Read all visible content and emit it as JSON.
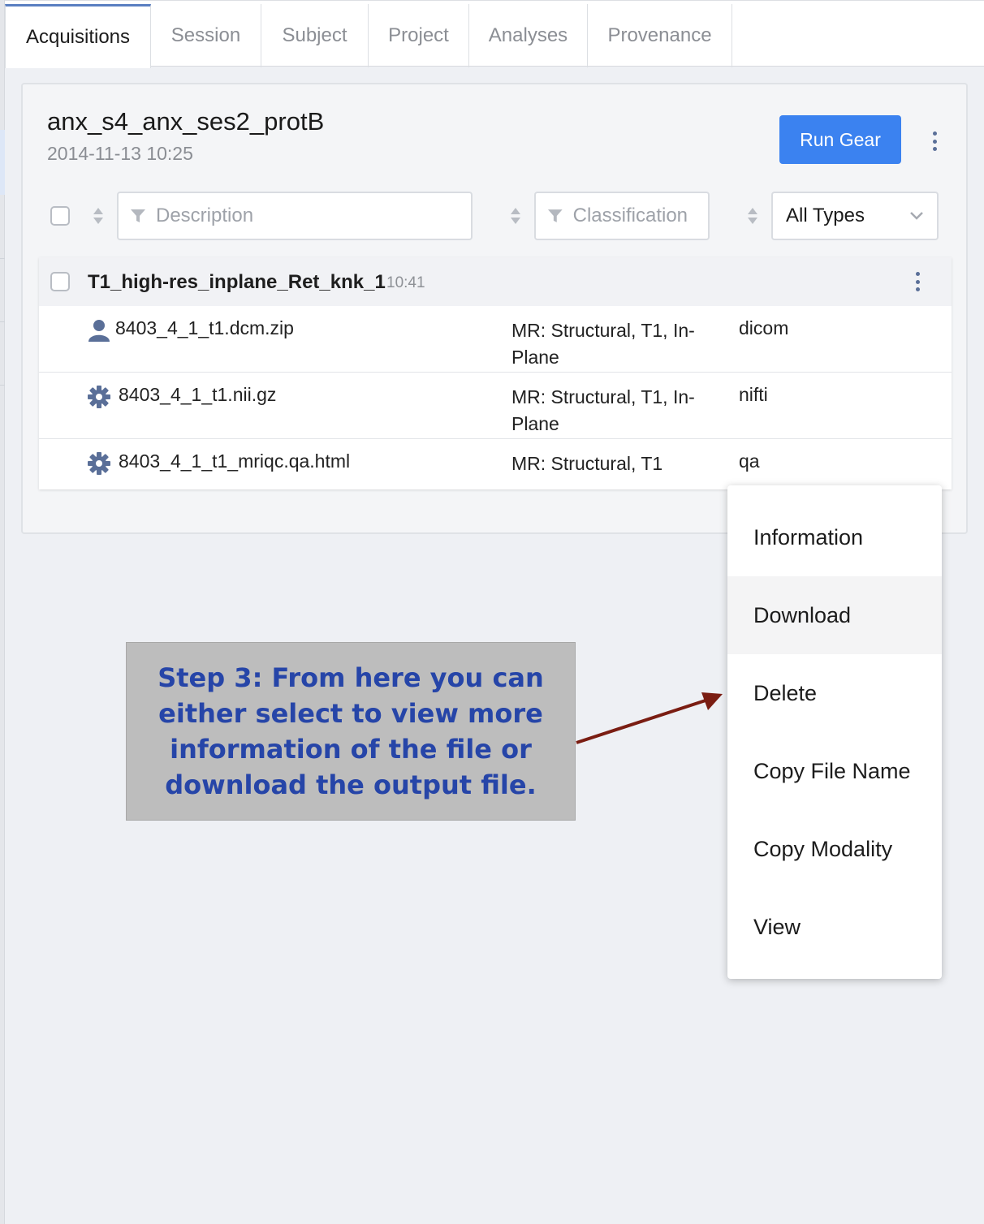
{
  "tabs": [
    {
      "label": "Acquisitions",
      "active": true
    },
    {
      "label": "Session"
    },
    {
      "label": "Subject"
    },
    {
      "label": "Project"
    },
    {
      "label": "Analyses"
    },
    {
      "label": "Provenance"
    }
  ],
  "header": {
    "title": "anx_s4_anx_ses2_protB",
    "timestamp": "2014-11-13 10:25",
    "run_gear_label": "Run Gear"
  },
  "filters": {
    "description_placeholder": "Description",
    "classification_placeholder": "Classification",
    "type_select_value": "All Types"
  },
  "acquisition": {
    "name": "T1_high-res_inplane_Ret_knk_1",
    "time": "10:41",
    "files": [
      {
        "icon": "user-icon",
        "name": "8403_4_1_t1.dcm.zip",
        "classification": "MR: Structural, T1, In-Plane",
        "type": "dicom"
      },
      {
        "icon": "gear-icon",
        "name": "8403_4_1_t1.nii.gz",
        "classification": "MR: Structural, T1, In-Plane",
        "type": "nifti"
      },
      {
        "icon": "gear-icon",
        "name": "8403_4_1_t1_mriqc.qa.html",
        "classification": "MR: Structural, T1",
        "type": "qa"
      }
    ]
  },
  "context_menu": {
    "items": [
      "Information",
      "Download",
      "Delete",
      "Copy File Name",
      "Copy Modality",
      "View"
    ],
    "highlighted": "Download"
  },
  "annotation": {
    "text": "Step 3: From here you can either select to view more information of the file or download the output file."
  },
  "colors": {
    "primary_button": "#3b82f0",
    "annotation_text": "#2645a8",
    "annotation_bg": "#bdbdbd",
    "arrow": "#7a1d12"
  }
}
